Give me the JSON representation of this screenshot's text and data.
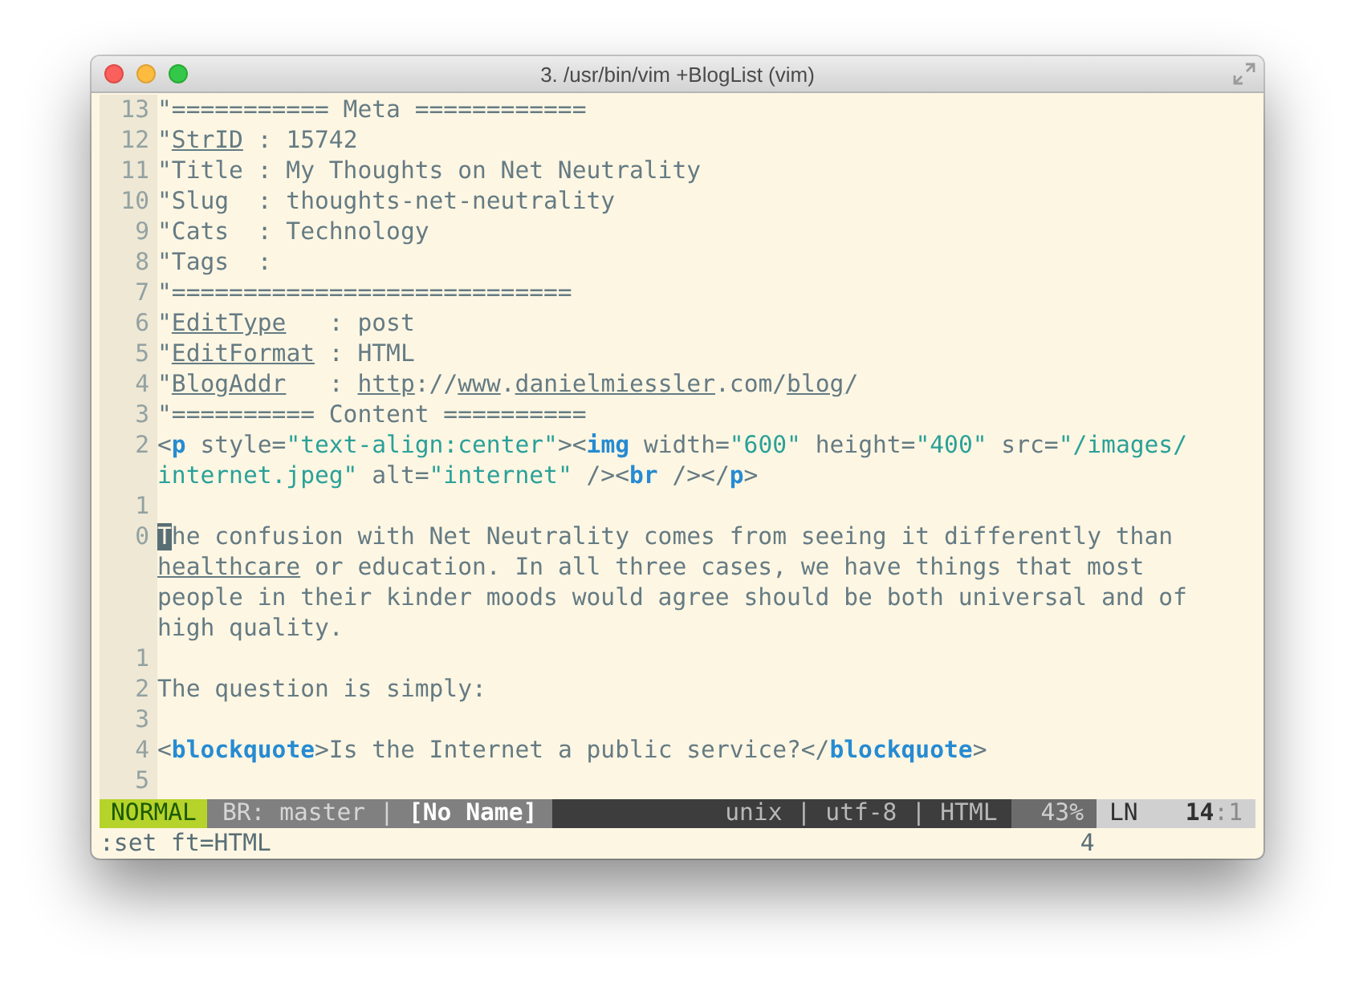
{
  "window": {
    "title": "3. /usr/bin/vim +BlogList (vim)"
  },
  "lines": [
    {
      "number": "13",
      "segments": [
        {
          "kind": "text",
          "text": "\"=========== Meta ============"
        }
      ]
    },
    {
      "number": "12",
      "segments": [
        {
          "kind": "text",
          "text": "\""
        },
        {
          "kind": "underline",
          "text": "StrID"
        },
        {
          "kind": "text",
          "text": " : 15742"
        }
      ]
    },
    {
      "number": "11",
      "segments": [
        {
          "kind": "text",
          "text": "\"Title : My Thoughts on Net Neutrality"
        }
      ]
    },
    {
      "number": "10",
      "segments": [
        {
          "kind": "text",
          "text": "\"Slug  : thoughts-net-neutrality"
        }
      ]
    },
    {
      "number": "9",
      "segments": [
        {
          "kind": "text",
          "text": "\"Cats  : Technology"
        }
      ]
    },
    {
      "number": "8",
      "segments": [
        {
          "kind": "text",
          "text": "\"Tags  :"
        }
      ]
    },
    {
      "number": "7",
      "segments": [
        {
          "kind": "text",
          "text": "\"============================"
        }
      ]
    },
    {
      "number": "6",
      "segments": [
        {
          "kind": "text",
          "text": "\""
        },
        {
          "kind": "underline",
          "text": "EditType"
        },
        {
          "kind": "text",
          "text": "   : post"
        }
      ]
    },
    {
      "number": "5",
      "segments": [
        {
          "kind": "text",
          "text": "\""
        },
        {
          "kind": "underline",
          "text": "EditFormat"
        },
        {
          "kind": "text",
          "text": " : HTML"
        }
      ]
    },
    {
      "number": "4",
      "segments": [
        {
          "kind": "text",
          "text": "\""
        },
        {
          "kind": "underline",
          "text": "BlogAddr"
        },
        {
          "kind": "text",
          "text": "   : "
        },
        {
          "kind": "underline",
          "text": "http"
        },
        {
          "kind": "text",
          "text": "://"
        },
        {
          "kind": "underline",
          "text": "www"
        },
        {
          "kind": "text",
          "text": "."
        },
        {
          "kind": "underline",
          "text": "danielmiessler"
        },
        {
          "kind": "text",
          "text": ".com/"
        },
        {
          "kind": "underline",
          "text": "blog"
        },
        {
          "kind": "text",
          "text": "/"
        }
      ]
    },
    {
      "number": "3",
      "segments": [
        {
          "kind": "text",
          "text": "\"========== Content =========="
        }
      ]
    },
    {
      "number": "2",
      "segments": [
        {
          "kind": "text",
          "text": "<"
        },
        {
          "kind": "tag",
          "text": "p"
        },
        {
          "kind": "text",
          "text": " style="
        },
        {
          "kind": "string",
          "text": "\"text-align:center\""
        },
        {
          "kind": "text",
          "text": "><"
        },
        {
          "kind": "tag",
          "text": "img"
        },
        {
          "kind": "text",
          "text": " width="
        },
        {
          "kind": "string",
          "text": "\"600\""
        },
        {
          "kind": "text",
          "text": " height="
        },
        {
          "kind": "string",
          "text": "\"400\""
        },
        {
          "kind": "text",
          "text": " src="
        },
        {
          "kind": "string",
          "text": "\"/images/"
        }
      ]
    },
    {
      "segments": [
        {
          "kind": "string",
          "text": "internet.jpeg\""
        },
        {
          "kind": "text",
          "text": " alt="
        },
        {
          "kind": "string",
          "text": "\"internet\""
        },
        {
          "kind": "text",
          "text": " /><"
        },
        {
          "kind": "tag",
          "text": "br"
        },
        {
          "kind": "text",
          "text": " /></"
        },
        {
          "kind": "tag",
          "text": "p"
        },
        {
          "kind": "text",
          "text": ">"
        }
      ]
    },
    {
      "number": "1"
    },
    {
      "number": "0",
      "segments": [
        {
          "kind": "cursor",
          "text": "T"
        },
        {
          "kind": "text",
          "text": "he confusion with Net Neutrality comes from seeing it differently than"
        }
      ]
    },
    {
      "segments": [
        {
          "kind": "underline",
          "text": "healthcare"
        },
        {
          "kind": "text",
          "text": " or education. In all three cases, we have things that most"
        }
      ]
    },
    {
      "segments": [
        {
          "kind": "text",
          "text": "people in their kinder moods would agree should be both universal and of"
        }
      ]
    },
    {
      "segments": [
        {
          "kind": "text",
          "text": "high quality."
        }
      ]
    },
    {
      "number": "1"
    },
    {
      "number": "2",
      "segments": [
        {
          "kind": "text",
          "text": "The question is simply:"
        }
      ]
    },
    {
      "number": "3"
    },
    {
      "number": "4",
      "segments": [
        {
          "kind": "text",
          "text": "<"
        },
        {
          "kind": "tag",
          "text": "blockquote"
        },
        {
          "kind": "text",
          "text": ">Is the Internet a public service?</"
        },
        {
          "kind": "tag",
          "text": "blockquote"
        },
        {
          "kind": "text",
          "text": ">"
        }
      ]
    },
    {
      "number": "5"
    }
  ],
  "status_bar": {
    "mode": "NORMAL",
    "branch": "BR: master",
    "separator": "|",
    "file": "[No Name]",
    "fileformat": "unix",
    "encoding": "utf-8",
    "filetype": "HTML",
    "percent": "43%",
    "ln_label": "LN",
    "line": "14",
    "column": ":1"
  },
  "command_line": {
    "command": ":set ft=HTML",
    "count": "4"
  }
}
